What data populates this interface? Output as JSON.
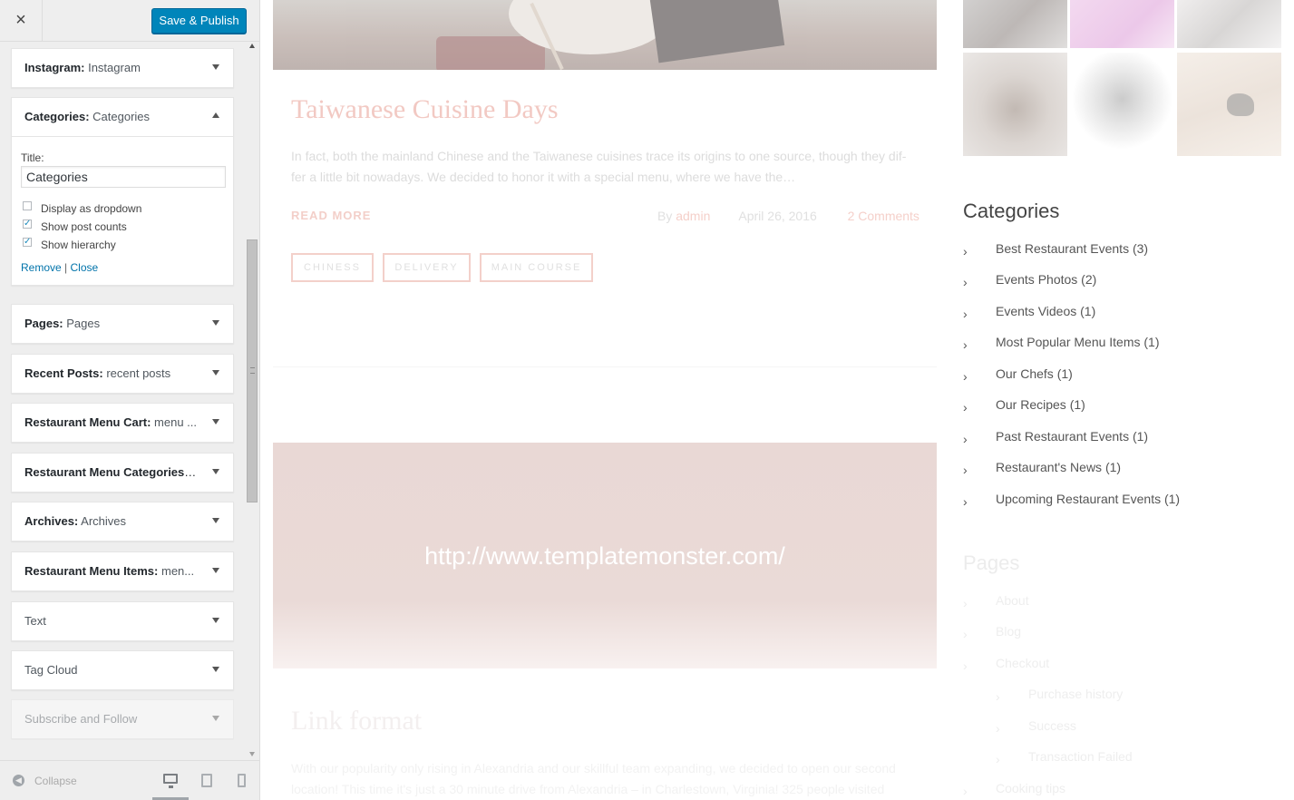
{
  "customizer": {
    "close_label": "×",
    "publish_label": "Save & Publish",
    "widgets": [
      {
        "name": "Instagram:",
        "instance": "Instagram",
        "expanded": false
      },
      {
        "name": "Categories:",
        "instance": "Categories",
        "expanded": true
      },
      {
        "name": "Pages:",
        "instance": "Pages",
        "expanded": false
      },
      {
        "name": "Recent Posts:",
        "instance": "recent posts",
        "expanded": false
      },
      {
        "name": "Restaurant Menu Cart:",
        "instance": "menu ...",
        "expanded": false
      },
      {
        "name": "Restaurant Menu Categories:",
        "instance": "...",
        "expanded": false
      },
      {
        "name": "Archives:",
        "instance": "Archives",
        "expanded": false
      },
      {
        "name": "Restaurant Menu Items:",
        "instance": "men...",
        "expanded": false
      },
      {
        "name": "Text",
        "instance": "",
        "expanded": false
      },
      {
        "name": "Tag Cloud",
        "instance": "",
        "expanded": false
      },
      {
        "name": "Subscribe and Follow",
        "instance": "",
        "expanded": false
      }
    ],
    "categories_form": {
      "title_label": "Title:",
      "title_value": "Categories",
      "options": [
        {
          "label": "Display as dropdown",
          "checked": false
        },
        {
          "label": "Show post counts",
          "checked": true
        },
        {
          "label": "Show hierarchy",
          "checked": true
        }
      ],
      "remove_label": "Remove",
      "separator": "|",
      "close_label": "Close"
    },
    "footer": {
      "collapse_label": "Collapse",
      "collapse_icon": "left-arrow-circle-icon",
      "devices": [
        "desktop-icon",
        "tablet-icon",
        "mobile-icon"
      ]
    }
  },
  "preview": {
    "post": {
      "title": "Taiwanese Cuisine Days",
      "excerpt_line1": "In fact, both the mainland Chinese and the Taiwanese cuisines trace its origins to one source, though they dif-",
      "excerpt_line2": "fer a little bit nowadays. We decided to honor it with a special menu, where we have the…",
      "read_more": "READ MORE",
      "by": "By",
      "author": "admin",
      "date": "April 26, 2016",
      "comments": "2 Comments",
      "tags": [
        "CHINESS",
        "DELIVERY",
        "MAIN COURSE"
      ]
    },
    "link_post": {
      "url": "http://www.templatemonster.com/",
      "title": "Link format",
      "text_line1": "With our popularity only rising in Alexandria and our skillful team expanding, we decided to open our second",
      "text_line2": "location! This time it's just a 30 minute drive from Alexandria – in Charlestown, Virginia! 325 people visited"
    },
    "categories_widget": {
      "title": "Categories",
      "items": [
        "Best Restaurant Events (3)",
        "Events Photos (2)",
        "Events Videos (1)",
        "Most Popular Menu Items (1)",
        "Our Chefs (1)",
        "Our Recipes (1)",
        "Past Restaurant Events (1)",
        "Restaurant's News (1)",
        "Upcoming Restaurant Events (1)"
      ]
    },
    "pages_widget": {
      "title": "Pages",
      "items": [
        {
          "label": "About",
          "level": 0
        },
        {
          "label": "Blog",
          "level": 0
        },
        {
          "label": "Checkout",
          "level": 0
        },
        {
          "label": "Purchase history",
          "level": 1
        },
        {
          "label": "Success",
          "level": 1
        },
        {
          "label": "Transaction Failed",
          "level": 1
        },
        {
          "label": "Cooking tips",
          "level": 0
        }
      ]
    },
    "chevron": "›"
  }
}
